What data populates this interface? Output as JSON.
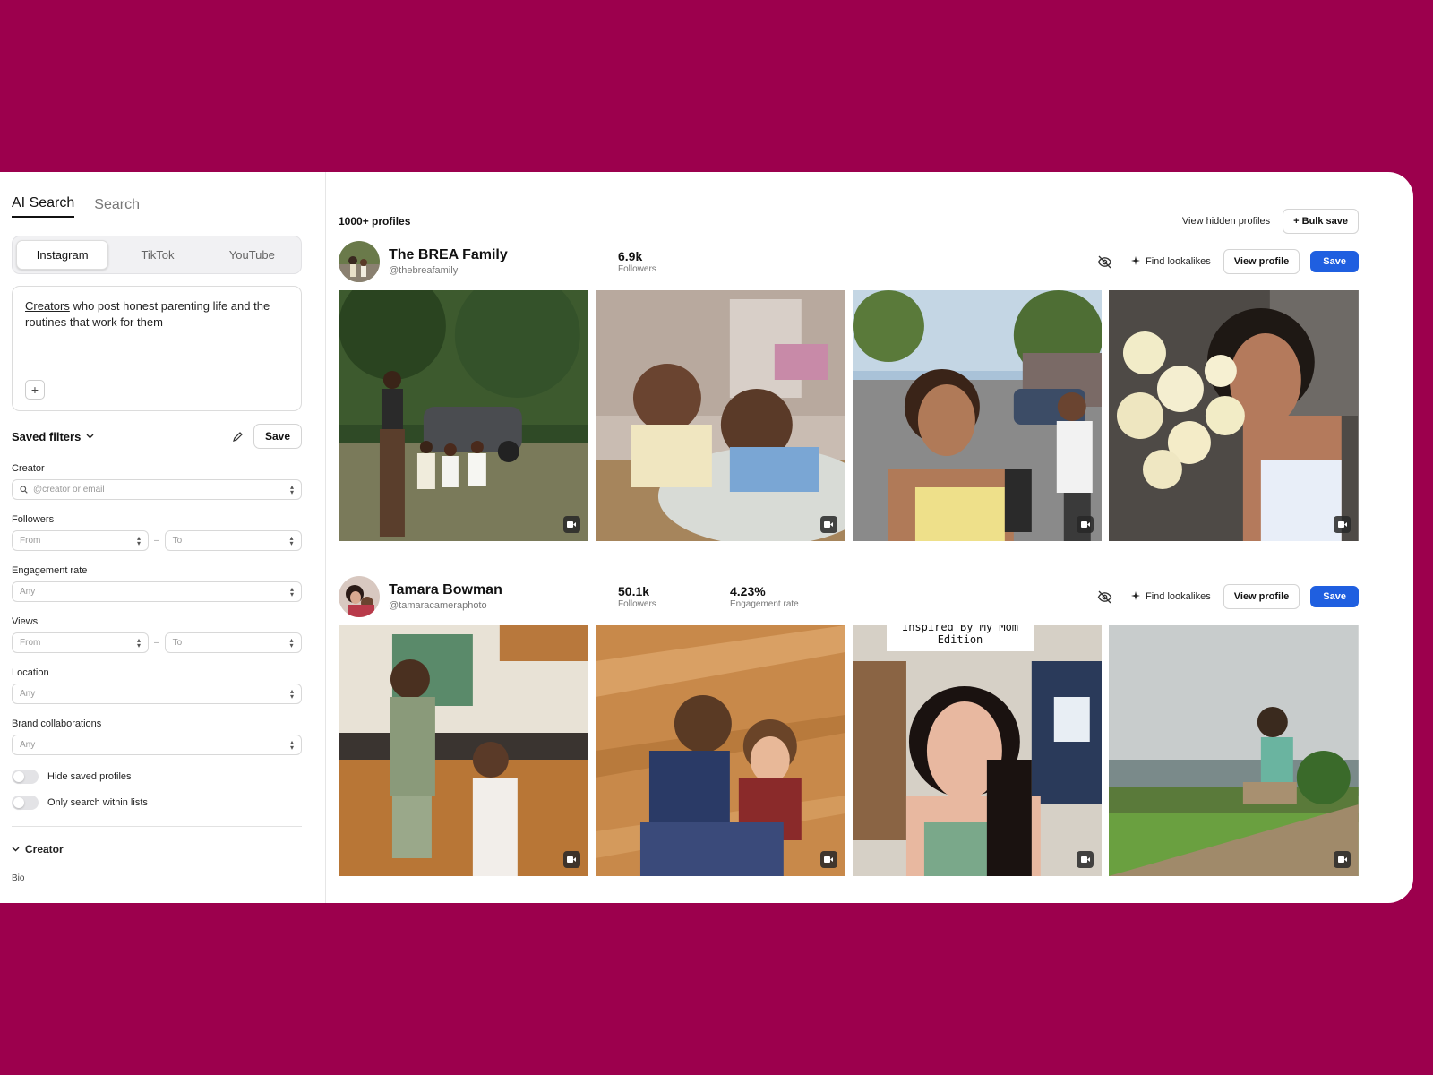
{
  "sidebar": {
    "modes": [
      {
        "label": "AI Search",
        "active": true
      },
      {
        "label": "Search",
        "active": false
      }
    ],
    "platforms": [
      {
        "label": "Instagram",
        "active": true
      },
      {
        "label": "TikTok",
        "active": false
      },
      {
        "label": "YouTube",
        "active": false
      }
    ],
    "prompt": {
      "underlined_word": "Creators",
      "rest": " who post honest parenting life and the routines that work for them"
    },
    "saved_filters": {
      "label": "Saved filters",
      "save_label": "Save"
    },
    "filters": {
      "creator": {
        "label": "Creator",
        "placeholder": "@creator or email"
      },
      "followers": {
        "label": "Followers",
        "from": "From",
        "to": "To"
      },
      "engagement": {
        "label": "Engagement rate",
        "value": "Any"
      },
      "views": {
        "label": "Views",
        "from": "From",
        "to": "To"
      },
      "location": {
        "label": "Location",
        "value": "Any"
      },
      "brand": {
        "label": "Brand collaborations",
        "value": "Any"
      }
    },
    "toggles": [
      {
        "label": "Hide saved profiles",
        "on": false
      },
      {
        "label": "Only search within lists",
        "on": false
      }
    ],
    "section": {
      "title": "Creator",
      "sub_label": "Bio"
    }
  },
  "main": {
    "results_count": "1000+ profiles",
    "view_hidden": "View hidden profiles",
    "bulk_save": "+ Bulk save",
    "find_lookalikes": "Find lookalikes",
    "view_profile": "View profile",
    "save": "Save",
    "profiles": [
      {
        "name": "The BREA Family",
        "handle": "@thebreafamily",
        "stats": [
          {
            "value": "6.9k",
            "label": "Followers"
          }
        ]
      },
      {
        "name": "Tamara Bowman",
        "handle": "@tamaracameraphoto",
        "stats": [
          {
            "value": "50.1k",
            "label": "Followers"
          },
          {
            "value": "4.23%",
            "label": "Engagement rate"
          }
        ],
        "overlay_caption": [
          "Inspired By My Mom",
          "Edition"
        ]
      }
    ]
  },
  "colors": {
    "background": "#9c004d",
    "primary_button": "#1f5fe0"
  }
}
